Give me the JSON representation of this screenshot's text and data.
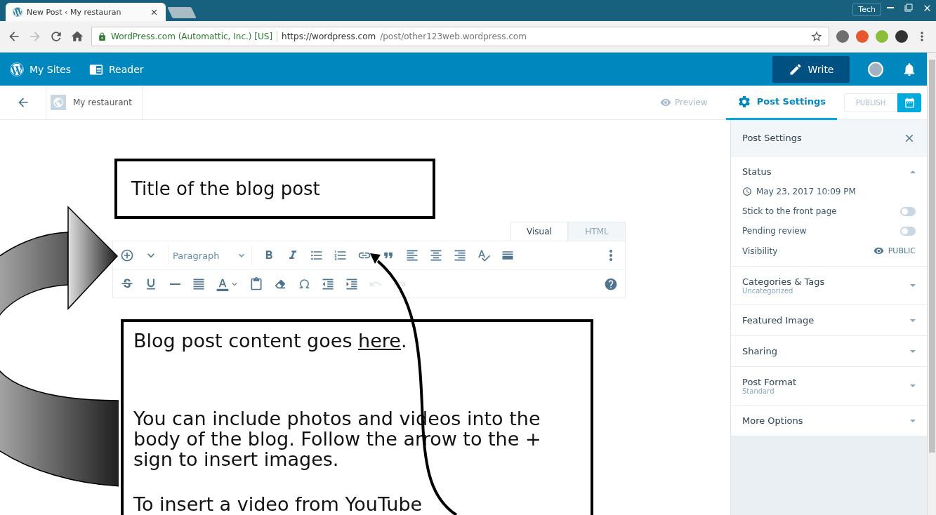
{
  "browser": {
    "tab": {
      "title": "New Post ‹ My restauran",
      "selected": true
    },
    "profile": "Tech",
    "address": {
      "secure_label": "WordPress.com (Automattic, Inc.) [US]",
      "url_host": "https://wordpress.com",
      "url_path": "/post/other123web.wordpress.com"
    }
  },
  "masterbar": {
    "items": [
      {
        "kind": "sites",
        "label": "My Sites"
      },
      {
        "kind": "reader",
        "label": "Reader"
      }
    ],
    "write": "Write"
  },
  "editor_header": {
    "site": "My restaurant",
    "preview": {
      "label": "Preview",
      "disabled": true
    },
    "settings_tab": {
      "label": "Post Settings",
      "selected": true
    },
    "publish": {
      "label": "PUBLISH",
      "disabled": true
    }
  },
  "editor": {
    "tabs": [
      {
        "label": "Visual",
        "selected": true
      },
      {
        "label": "HTML",
        "selected": false
      }
    ],
    "toolbar_rows": [
      [
        {
          "kind": "insert",
          "disabled": false
        },
        {
          "kind": "insert-menu",
          "disabled": false
        },
        {
          "kind": "format-select",
          "label": "Paragraph",
          "disabled": false
        },
        {
          "kind": "bold",
          "disabled": false
        },
        {
          "kind": "italic",
          "disabled": false
        },
        {
          "kind": "bullets",
          "disabled": false
        },
        {
          "kind": "numbers",
          "disabled": false
        },
        {
          "kind": "link",
          "disabled": false
        },
        {
          "kind": "quote",
          "disabled": false
        },
        {
          "kind": "align-left",
          "disabled": false
        },
        {
          "kind": "align-center",
          "disabled": false
        },
        {
          "kind": "align-right",
          "disabled": false
        },
        {
          "kind": "spellcheck",
          "disabled": false
        },
        {
          "kind": "more",
          "disabled": false
        },
        {
          "kind": "toggle",
          "disabled": false
        }
      ],
      [
        {
          "kind": "strike",
          "disabled": false
        },
        {
          "kind": "underline",
          "disabled": false
        },
        {
          "kind": "hr",
          "disabled": false
        },
        {
          "kind": "justify",
          "disabled": false
        },
        {
          "kind": "text-color",
          "disabled": false
        },
        {
          "kind": "paste",
          "disabled": false
        },
        {
          "kind": "clear",
          "disabled": false
        },
        {
          "kind": "omega",
          "disabled": false
        },
        {
          "kind": "outdent",
          "disabled": false
        },
        {
          "kind": "indent",
          "disabled": false
        },
        {
          "kind": "undo",
          "disabled": true
        },
        {
          "kind": "redo",
          "disabled": true
        },
        {
          "kind": "help",
          "disabled": false
        }
      ]
    ]
  },
  "callouts": {
    "title_note": "Title of the blog post",
    "content_note": {
      "before": "Blog post content goes ",
      "link": "here",
      "after": ".",
      "paragraphs": [
        "You can include photos and videos into the body of the blog. Follow the arrow to the + sign to insert images.",
        "To insert a video from YouTube"
      ]
    }
  },
  "sidebar": {
    "title": "Post Settings",
    "sections": [
      {
        "title": "Status",
        "expanded": true,
        "date": "May 23, 2017 10:09 PM",
        "toggles": [
          {
            "label": "Stick to the front page",
            "on": false
          },
          {
            "label": "Pending review",
            "on": false
          }
        ],
        "visibility": {
          "label": "Visibility",
          "value": "PUBLIC"
        }
      },
      {
        "title": "Categories & Tags",
        "subtitle": "Uncategorized",
        "expanded": false
      },
      {
        "title": "Featured Image",
        "expanded": false
      },
      {
        "title": "Sharing",
        "expanded": false
      },
      {
        "title": "Post Format",
        "subtitle": "Standard",
        "expanded": false
      },
      {
        "title": "More Options",
        "expanded": false
      }
    ]
  }
}
